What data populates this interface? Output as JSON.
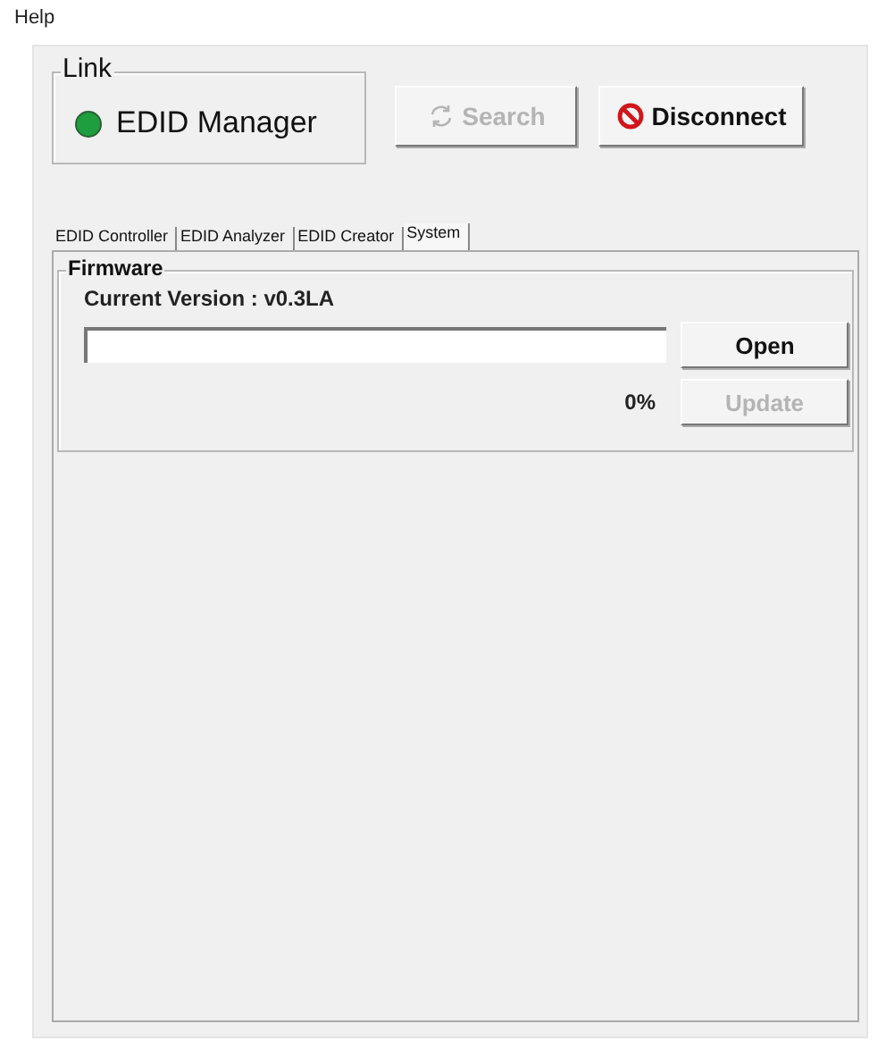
{
  "menu": [
    {
      "label": "Help"
    }
  ],
  "link": {
    "title": "Link",
    "connected": true,
    "device": "EDID Manager"
  },
  "buttons": [
    {
      "kind": "search",
      "label": "Search",
      "disabled": true
    },
    {
      "kind": "disconnect",
      "label": "Disconnect",
      "disabled": false
    }
  ],
  "tabs": [
    {
      "label": "EDID Controller",
      "selected": false
    },
    {
      "label": "EDID Analyzer",
      "selected": false
    },
    {
      "label": "EDID Creator",
      "selected": false
    },
    {
      "label": "System",
      "selected": true
    }
  ],
  "firmware": {
    "title": "Firmware",
    "version": "Current Version : v0.3LA",
    "progress_text": "0%",
    "open_button": {
      "label": "Open",
      "disabled": false
    },
    "update_button": {
      "label": "Update",
      "disabled": true
    }
  }
}
